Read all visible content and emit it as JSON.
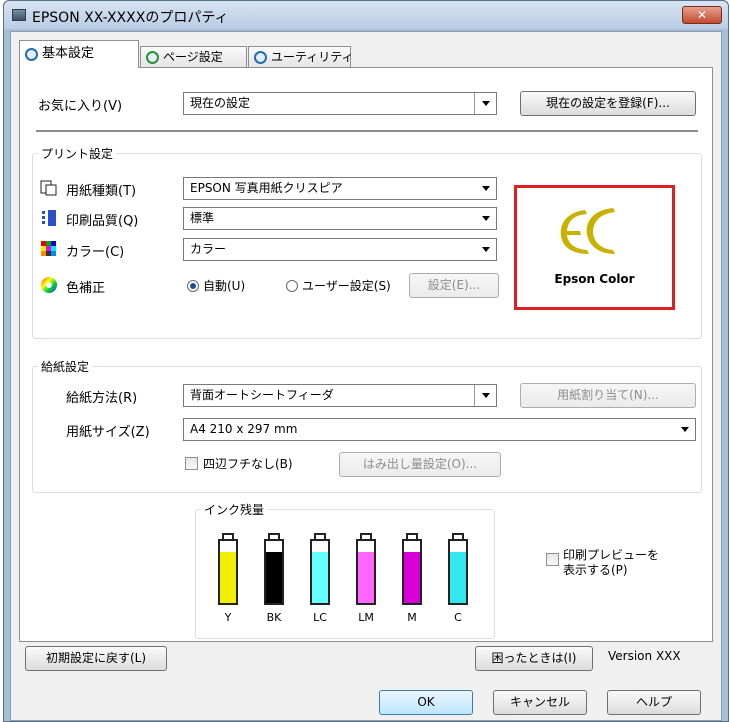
{
  "window": {
    "title": "EPSON XX-XXXXのプロパティ",
    "close_label": "✕"
  },
  "tabs": [
    {
      "label": "基本設定",
      "active": true
    },
    {
      "label": "ページ設定",
      "active": false
    },
    {
      "label": "ユーティリティ",
      "active": false
    }
  ],
  "favorites": {
    "label": "お気に入り(V)",
    "value": "現在の設定",
    "register_button": "現在の設定を登録(F)..."
  },
  "print_settings": {
    "group_title": "プリント設定",
    "paper_type": {
      "label": "用紙種類(T)",
      "value": "EPSON 写真用紙クリスピア"
    },
    "quality": {
      "label": "印刷品質(Q)",
      "value": "標準"
    },
    "color": {
      "label": "カラー(C)",
      "value": "カラー"
    },
    "color_correction": {
      "label": "色補正",
      "auto_label": "自動(U)",
      "user_label": "ユーザー設定(S)",
      "settings_button": "設定(E)...",
      "selected": "auto"
    },
    "logo": {
      "mark": "EC",
      "text": "Epson Color",
      "color": "#c9b100"
    }
  },
  "paper_settings": {
    "group_title": "給紙設定",
    "source": {
      "label": "給紙方法(R)",
      "value": "背面オートシートフィーダ",
      "assign_button": "用紙割り当て(N)..."
    },
    "size": {
      "label": "用紙サイズ(Z)",
      "value": "A4 210 x 297 mm"
    },
    "borderless": {
      "label": "四辺フチなし(B)",
      "checked": false
    },
    "expansion_button": "はみ出し量設定(O)..."
  },
  "ink": {
    "group_title": "インク残量",
    "cartridges": [
      {
        "label": "Y",
        "color": "#f2ee00",
        "level": 0.82
      },
      {
        "label": "BK",
        "color": "#000000",
        "level": 0.82
      },
      {
        "label": "LC",
        "color": "#66ffff",
        "level": 0.82
      },
      {
        "label": "LM",
        "color": "#ff66ff",
        "level": 0.82
      },
      {
        "label": "M",
        "color": "#d800d8",
        "level": 0.82
      },
      {
        "label": "C",
        "color": "#33e6f0",
        "level": 0.82
      }
    ],
    "preview_label_1": "印刷プレビューを",
    "preview_label_2": "表示する(P)"
  },
  "footer": {
    "reset_button": "初期設定に戻す(L)",
    "help_trouble_button": "困ったときは(I)",
    "version": "Version XXX"
  },
  "dialog_buttons": {
    "ok": "OK",
    "cancel": "キャンセル",
    "help": "ヘルプ"
  }
}
